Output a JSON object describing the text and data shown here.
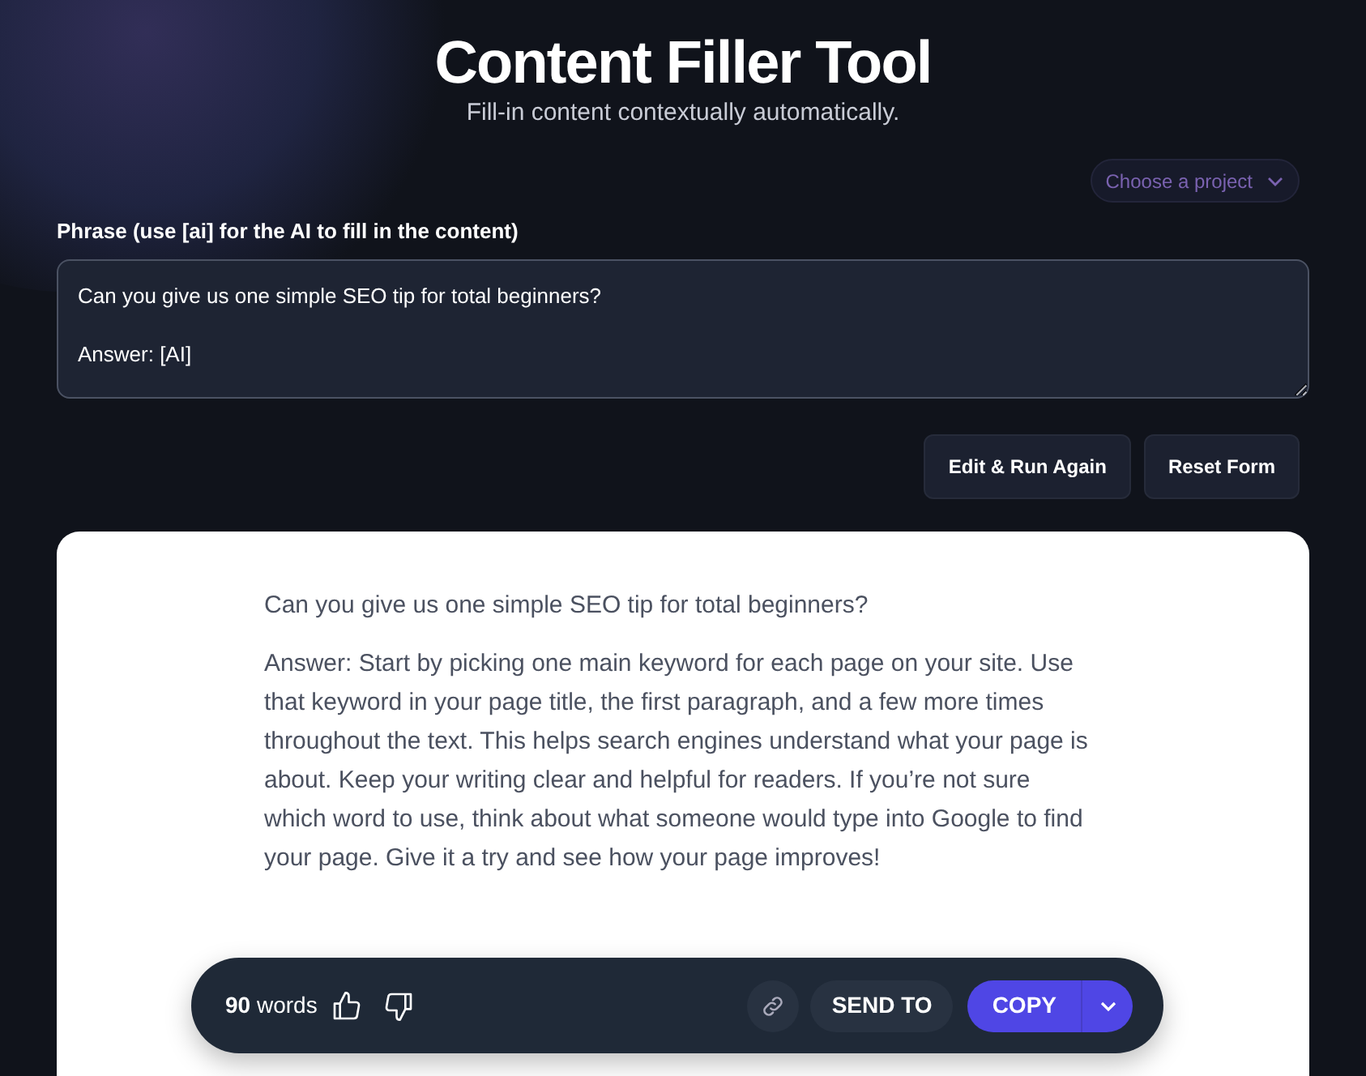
{
  "header": {
    "title": "Content Filler Tool",
    "subtitle": "Fill-in content contextually automatically."
  },
  "project_select": {
    "label": "Choose a project"
  },
  "phrase": {
    "label": "Phrase (use [ai] for the AI to fill in the content)",
    "value": "Can you give us one simple SEO tip for total beginners?\n\nAnswer: [AI]"
  },
  "actions": [
    "Edit & Run Again",
    "Reset Form"
  ],
  "result": {
    "paragraphs": [
      "Can you give us one simple SEO tip for total beginners?",
      "Answer: Start by picking one main keyword for each page on your site. Use that keyword in your page title, the first paragraph, and a few more times throughout the text. This helps search engines understand what your page is about. Keep your writing clear and helpful for readers. If you’re not sure which word to use, think about what someone would type into Google to find your page. Give it a try and see how your page improves!"
    ]
  },
  "toolbar": {
    "word_count": "**90** words",
    "send_to": "SEND TO",
    "copy": "COPY"
  }
}
